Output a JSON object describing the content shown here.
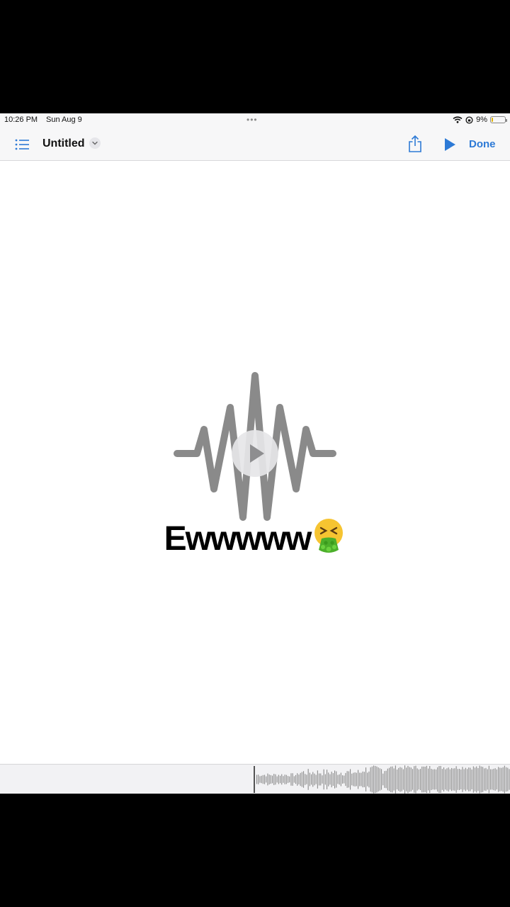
{
  "status_bar": {
    "time": "10:26 PM",
    "date": "Sun Aug 9",
    "multitask_dots": "•••",
    "battery_percent": "9%",
    "battery_level": 0.09
  },
  "toolbar": {
    "title": "Untitled",
    "done_label": "Done",
    "icons": [
      "list-icon",
      "chevron-down-icon",
      "share-icon",
      "play-icon"
    ]
  },
  "caption": {
    "text": "Ewwwww",
    "emoji": "nauseated-vomit-emoji"
  },
  "colors": {
    "accent": "#2d7ad6",
    "wave_gray": "#8a8a8a",
    "background": "#ffffff"
  }
}
